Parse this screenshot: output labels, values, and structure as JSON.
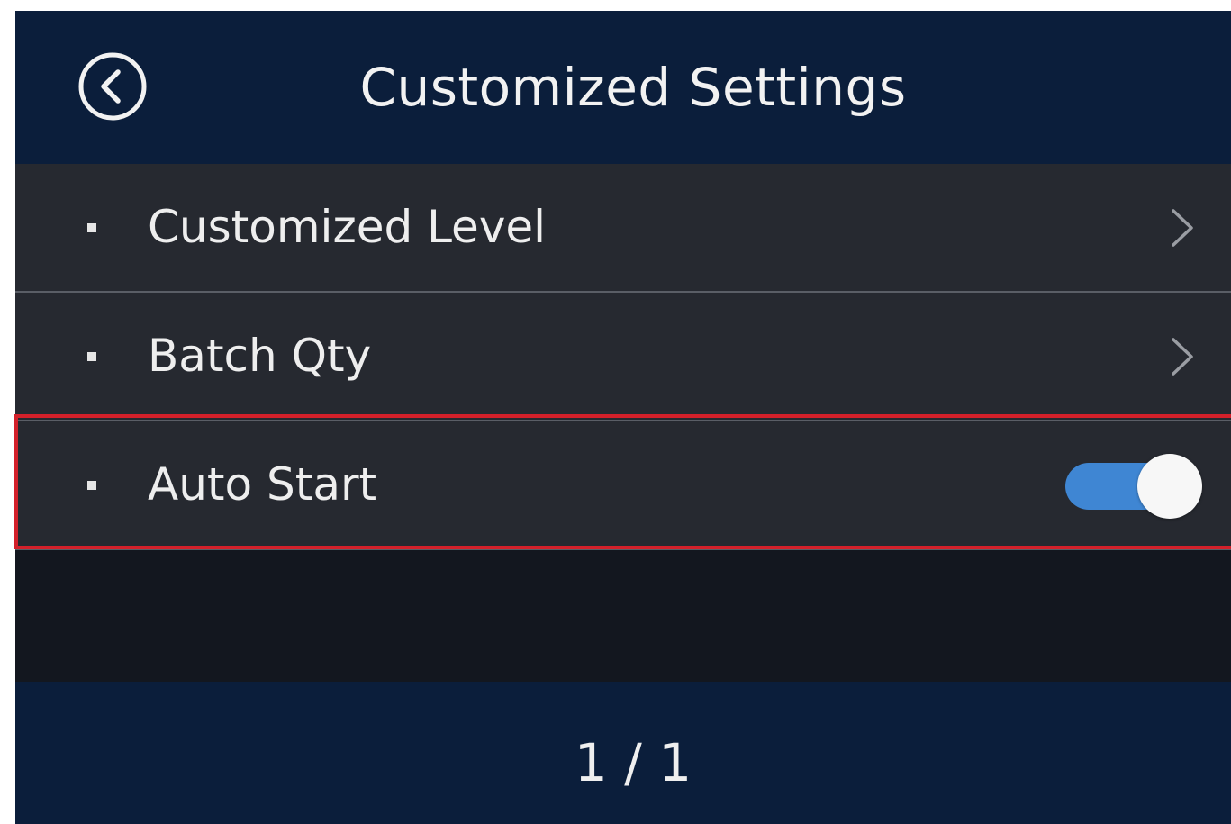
{
  "header": {
    "title": "Customized Settings",
    "back_icon": "back-circle-icon"
  },
  "menu": {
    "items": [
      {
        "label": "Customized Level",
        "control": "chevron-right-icon"
      },
      {
        "label": "Batch Qty",
        "control": "chevron-right-icon"
      },
      {
        "label": "Auto Start",
        "control": "toggle",
        "toggle_on": true
      }
    ]
  },
  "footer": {
    "pagination": "1 / 1"
  },
  "colors": {
    "header_bg": "#0b1e3b",
    "row_bg": "#262930",
    "screen_bg": "#13171f",
    "toggle_on": "#3f86d3",
    "highlight_border": "#d3202a"
  }
}
